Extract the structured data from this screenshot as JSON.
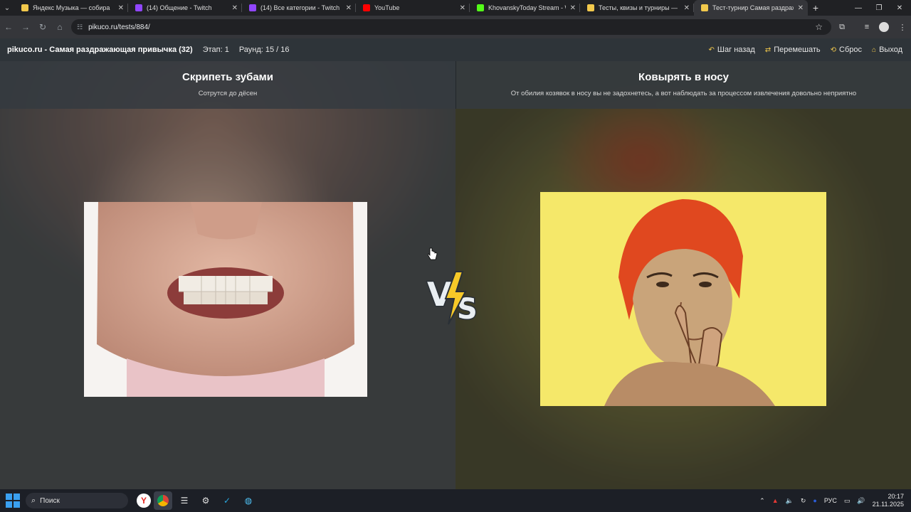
{
  "browser": {
    "tabs": [
      {
        "title": "Яндекс Музыка — собира",
        "favicon_color": "#f2c94c",
        "active": false
      },
      {
        "title": "(14) Общение - Twitch",
        "favicon_color": "#9146ff",
        "active": false
      },
      {
        "title": "(14) Все категории - Twitch",
        "favicon_color": "#9146ff",
        "active": false
      },
      {
        "title": "YouTube",
        "favicon_color": "#ff0000",
        "active": false
      },
      {
        "title": "KhovanskyToday Stream - Wat",
        "favicon_color": "#53fc18",
        "active": false
      },
      {
        "title": "Тесты, квизы и турниры — Pi",
        "favicon_color": "#f2c94c",
        "active": false
      },
      {
        "title": "Тест-турнир Самая раздража",
        "favicon_color": "#f2c94c",
        "active": true
      }
    ],
    "new_tab_label": "+",
    "url": "pikuco.ru/tests/884/"
  },
  "site_header": {
    "title": "pikuco.ru - Самая раздражающая привычка (32)",
    "stage": "Этап: 1",
    "round": "Раунд: 15 / 16",
    "actions": [
      {
        "label": "Шаг назад",
        "icon": "undo-icon"
      },
      {
        "label": "Перемешать",
        "icon": "shuffle-icon"
      },
      {
        "label": "Сброс",
        "icon": "reset-icon"
      },
      {
        "label": "Выход",
        "icon": "home-icon"
      }
    ]
  },
  "matchup": {
    "left": {
      "name": "Скрипеть зубами",
      "description": "Сотрутся до дёсен"
    },
    "right": {
      "name": "Ковырять в носу",
      "description": "От обилия козявок в носу вы не задохнетесь, а вот наблюдать за процессом извлечения довольно неприятно"
    },
    "vs_label": "VS"
  },
  "taskbar": {
    "search_placeholder": "Поиск",
    "language": "РУС",
    "time": "20:17",
    "date": "21.11.2025"
  }
}
